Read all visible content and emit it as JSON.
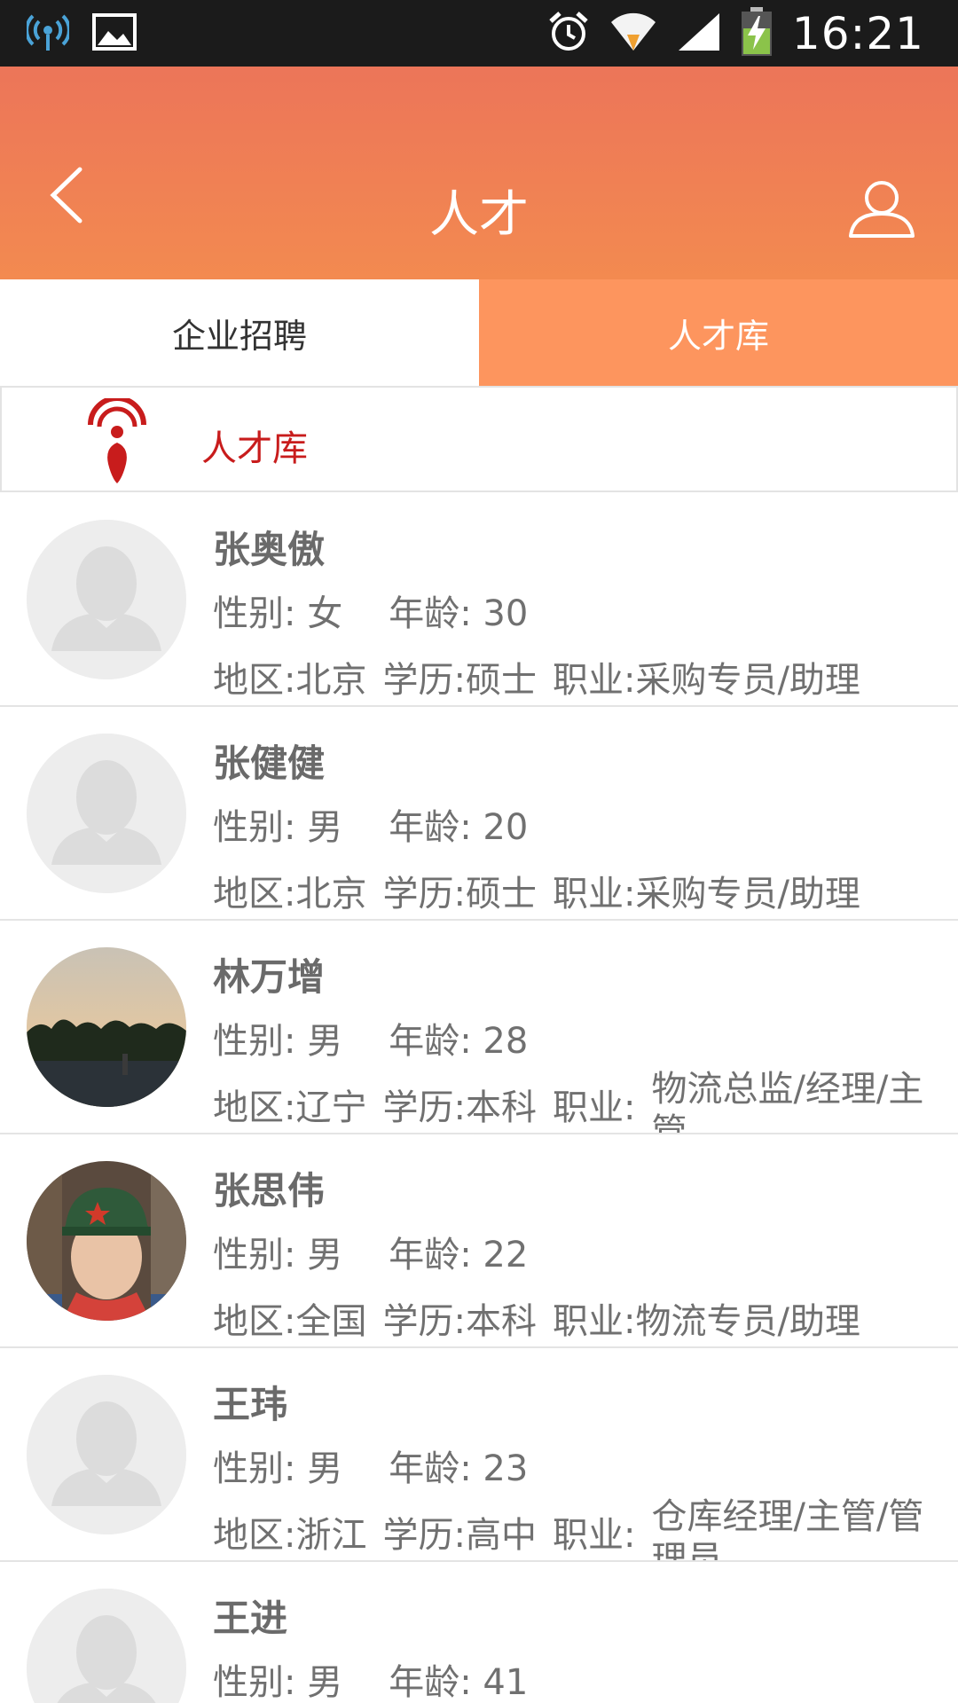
{
  "status_bar": {
    "time": "16:21",
    "icons": [
      "wireless-broadcast-icon",
      "image-icon",
      "alarm-icon",
      "wifi-icon",
      "signal-icon",
      "battery-charging-icon"
    ]
  },
  "header": {
    "title": "人才",
    "back_icon": "chevron-left-icon",
    "user_icon": "user-icon",
    "gradient": [
      "#ec7559",
      "#f38a50"
    ]
  },
  "tabs": [
    {
      "label": "企业招聘",
      "active": false
    },
    {
      "label": "人才库",
      "active": true
    }
  ],
  "section": {
    "label": "人才库",
    "icon": "location-pin-signal-icon",
    "color": "#c81c1c"
  },
  "candidates": [
    {
      "name": "张奥傲",
      "gender": "性别: 女",
      "age": "年龄: 30",
      "region": "地区:北京",
      "education": "学历:硕士",
      "job": "职业:采购专员/助理",
      "avatar": "default"
    },
    {
      "name": "张健健",
      "gender": "性别: 男",
      "age": "年龄: 20",
      "region": "地区:北京",
      "education": "学历:硕士",
      "job": "职业:采购专员/助理",
      "avatar": "default"
    },
    {
      "name": "林万增",
      "gender": "性别: 男",
      "age": "年龄: 28",
      "region": "地区:辽宁",
      "education": "学历:本科",
      "job_label": "职业:",
      "job_value": "物流总监/经理/主管",
      "avatar": "sunset-photo"
    },
    {
      "name": "张思伟",
      "gender": "性别: 男",
      "age": "年龄: 22",
      "region": "地区:全国",
      "education": "学历:本科",
      "job": "职业:物流专员/助理",
      "avatar": "portrait-photo"
    },
    {
      "name": "王玮",
      "gender": "性别: 男",
      "age": "年龄: 23",
      "region": "地区:浙江",
      "education": "学历:高中",
      "job_label": "职业:",
      "job_value": "仓库经理/主管/管理员",
      "avatar": "default"
    },
    {
      "name": "王进",
      "gender": "性别: 男",
      "age": "年龄: 41",
      "avatar": "default"
    }
  ]
}
